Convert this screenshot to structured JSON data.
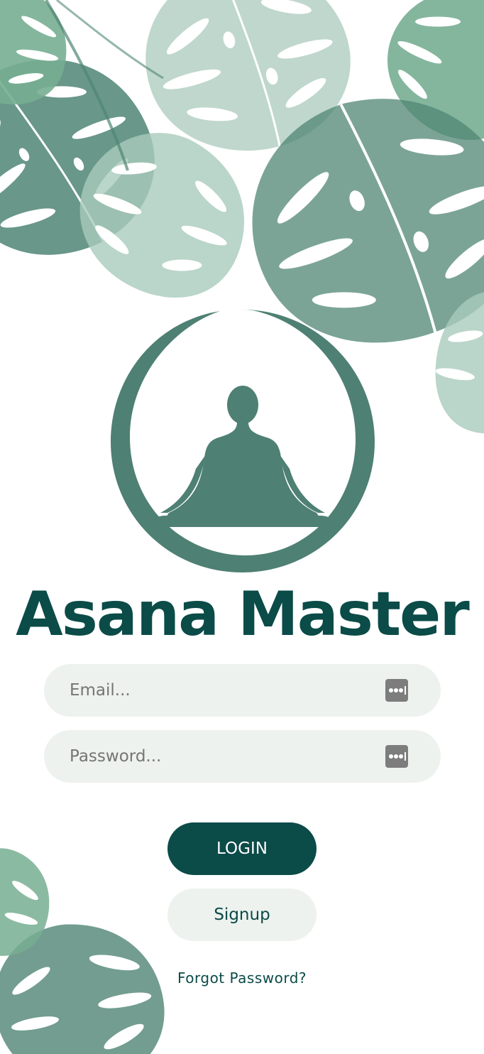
{
  "app": {
    "title": "Asana Master"
  },
  "form": {
    "email_placeholder": "Email...",
    "password_placeholder": "Password..."
  },
  "buttons": {
    "login_label": "LOGIN",
    "signup_label": "Signup"
  },
  "links": {
    "forgot_password": "Forgot Password?"
  },
  "icons": {
    "logo": "meditation-logo",
    "field_autofill": "password-keychain-icon",
    "background": "monstera-leaf"
  },
  "colors": {
    "primary": "#0b4b48",
    "logo": "#4e8073",
    "field_bg": "#edf2ee",
    "leaf_dark": "#4f8574",
    "leaf_mid": "#77ae92",
    "leaf_light": "#a9cabc",
    "icon_gray": "#7d7d7d"
  }
}
